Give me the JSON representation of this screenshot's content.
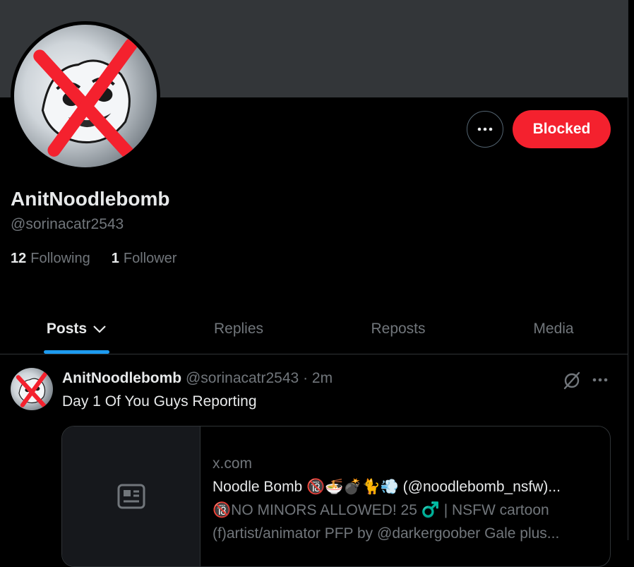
{
  "profile": {
    "display_name": "AnitNoodlebomb",
    "handle": "@sorinacatr2543",
    "following_count": "12",
    "following_label": "Following",
    "followers_count": "1",
    "followers_label": "Follower"
  },
  "actions": {
    "more_icon": "more-horizontal-icon",
    "blocked_label": "Blocked",
    "blocked_color": "#f4212e"
  },
  "tabs": [
    {
      "label": "Posts",
      "active": true
    },
    {
      "label": "Replies",
      "active": false
    },
    {
      "label": "Reposts",
      "active": false
    },
    {
      "label": "Media",
      "active": false
    }
  ],
  "accent_color": "#1d9bf0",
  "post": {
    "author_name": "AnitNoodlebomb",
    "author_handle": "@sorinacatr2543",
    "separator": "·",
    "time": "2m",
    "text": "Day 1 Of You Guys Reporting",
    "card": {
      "domain": "x.com",
      "title": "Noodle Bomb 🔞🍜💣🐈💨 (@noodlebomb_nsfw)...",
      "desc_line1": "🔞NO MINORS ALLOWED! 25 ♂️ | NSFW cartoon",
      "desc_line2": "(f)artist/animator PFP by @darkergoober Gale plus..."
    }
  }
}
